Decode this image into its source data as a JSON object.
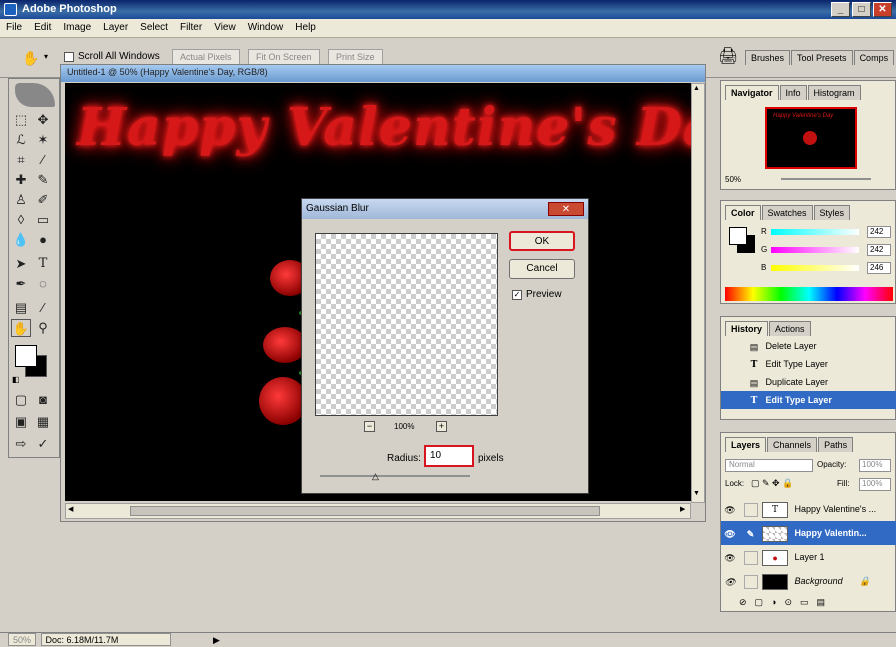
{
  "app": {
    "title": "Adobe Photoshop"
  },
  "menu": [
    "File",
    "Edit",
    "Image",
    "Layer",
    "Select",
    "Filter",
    "View",
    "Window",
    "Help"
  ],
  "options": {
    "scroll_all_windows": "Scroll All Windows",
    "actual_pixels": "Actual Pixels",
    "fit_on_screen": "Fit On Screen",
    "print_size": "Print Size"
  },
  "palette_well": [
    "Brushes",
    "Tool Presets",
    "Comps"
  ],
  "document": {
    "title": "Untitled-1 @ 50% (Happy Valentine's Day, RGB/8)",
    "heading": "Happy Valentine's Day"
  },
  "dialog": {
    "title": "Gaussian Blur",
    "ok": "OK",
    "cancel": "Cancel",
    "preview_label": "Preview",
    "zoom": "100%",
    "radius_label": "Radius:",
    "radius_value": "10",
    "units": "pixels"
  },
  "navigator": {
    "tabs": [
      "Navigator",
      "Info",
      "Histogram"
    ],
    "zoom": "50%"
  },
  "color": {
    "tabs": [
      "Color",
      "Swatches",
      "Styles"
    ],
    "r_label": "R",
    "g_label": "G",
    "b_label": "B",
    "r": "242",
    "g": "242",
    "b": "246"
  },
  "history": {
    "tabs": [
      "History",
      "Actions"
    ],
    "items": [
      "Delete Layer",
      "Edit Type Layer",
      "Duplicate Layer",
      "Edit Type Layer"
    ],
    "active_index": 3
  },
  "layers": {
    "tabs": [
      "Layers",
      "Channels",
      "Paths"
    ],
    "blend_mode": "Normal",
    "opacity_label": "Opacity:",
    "opacity": "100%",
    "lock_label": "Lock:",
    "fill_label": "Fill:",
    "fill": "100%",
    "items": [
      "Happy Valentine's ...",
      "Happy Valentin...",
      "Layer 1",
      "Background"
    ],
    "active_index": 1
  },
  "status": {
    "zoom": "50%",
    "doc": "Doc: 6.18M/11.7M"
  },
  "colors": {
    "accent": "#316ac5",
    "highlight_red": "#d8141e",
    "text_glow": "#d71818"
  }
}
